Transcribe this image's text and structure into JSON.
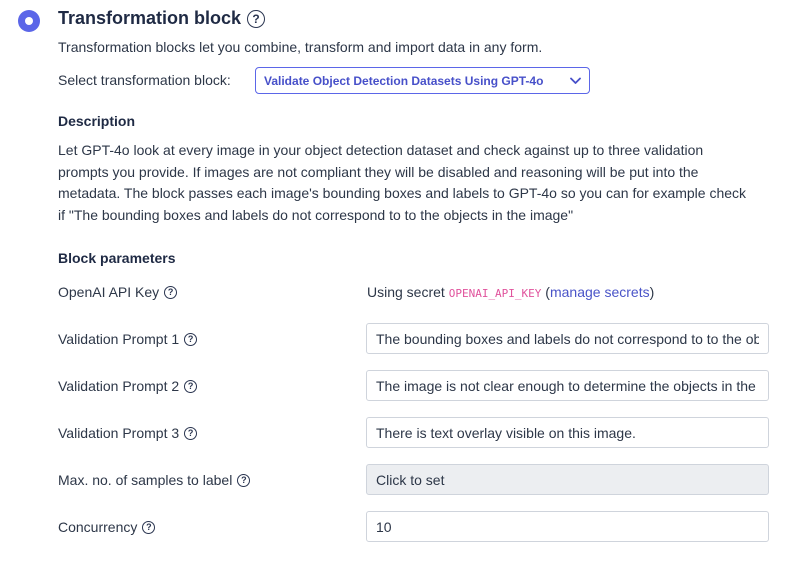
{
  "header": {
    "title": "Transformation block",
    "subtitle": "Transformation blocks let you combine, transform and import data in any form."
  },
  "select": {
    "label": "Select transformation block:",
    "value": "Validate Object Detection Datasets Using GPT-4o"
  },
  "description": {
    "heading": "Description",
    "lines": [
      "Let GPT-4o look at every image in your object detection dataset and check against up to three validation",
      "prompts you provide. If images are not compliant they will be disabled and reasoning will be put into the",
      "metadata. The block passes each image's bounding boxes and labels to GPT-4o so you can for example check",
      "if \"The bounding boxes and labels do not correspond to to the objects in the image\""
    ]
  },
  "params": {
    "heading": "Block parameters",
    "api_key": {
      "label": "OpenAI API Key",
      "prefix": "Using secret ",
      "secret": "OPENAI_API_KEY",
      "open_paren": " (",
      "link": "manage secrets",
      "close_paren": ")"
    },
    "prompt1": {
      "label": "Validation Prompt 1",
      "value": "The bounding boxes and labels do not correspond to to the objects in the image"
    },
    "prompt2": {
      "label": "Validation Prompt 2",
      "value": "The image is not clear enough to determine the objects in the image"
    },
    "prompt3": {
      "label": "Validation Prompt 3",
      "value": "There is text overlay visible on this image."
    },
    "max_samples": {
      "label": "Max. no. of samples to label",
      "value": "Click to set"
    },
    "concurrency": {
      "label": "Concurrency",
      "value": "10"
    }
  },
  "help_glyph": "?",
  "colors": {
    "accent": "#5b66e8",
    "secret": "#e0529c",
    "link": "#4a54c8"
  }
}
